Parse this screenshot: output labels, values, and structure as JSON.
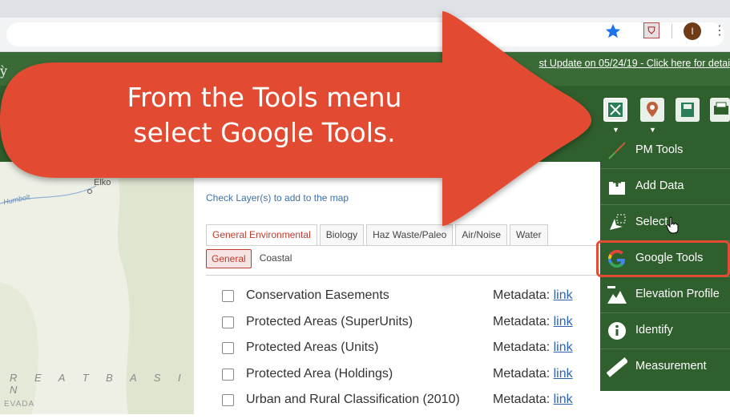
{
  "browser": {
    "profile_initial": "I",
    "menu_glyph": "⋮"
  },
  "header": {
    "update_link": "st Update on 05/24/19 - Click here for detai",
    "title_fragment": "ỳ"
  },
  "map": {
    "city": "Elko",
    "river": "Humbolt",
    "basin": "R E A T   B A S I N",
    "state": "EVADA"
  },
  "panel": {
    "hint": "Check Layer(s) to add to the map",
    "tabs": [
      {
        "label": "General Environmental",
        "active": true
      },
      {
        "label": "Biology"
      },
      {
        "label": "Haz Waste/Paleo"
      },
      {
        "label": "Air/Noise"
      },
      {
        "label": "Water"
      }
    ],
    "subtabs": [
      {
        "label": "General",
        "active": true
      },
      {
        "label": "Coastal"
      }
    ],
    "metadata_label": "Metadata:",
    "link_label": "link",
    "layers": [
      "Conservation Easements",
      "Protected Areas (SuperUnits)",
      "Protected Areas (Units)",
      "Protected Area (Holdings)",
      "Urban and Rural Classification (2010)"
    ]
  },
  "tools_menu": {
    "items": [
      {
        "label": "PM Tools",
        "icon": "pm-tools-icon"
      },
      {
        "label": "Add Data",
        "icon": "add-data-icon"
      },
      {
        "label": "Select",
        "icon": "select-icon"
      },
      {
        "label": "Google Tools",
        "icon": "google-icon"
      },
      {
        "label": "Elevation Profile",
        "icon": "elevation-profile-icon"
      },
      {
        "label": "Identify",
        "icon": "identify-icon"
      },
      {
        "label": "Measurement",
        "icon": "measurement-icon"
      }
    ],
    "highlighted": "Google Tools"
  },
  "callout": {
    "line1": "From the Tools menu",
    "line2": "select Google Tools."
  },
  "colors": {
    "header_green": "#3a6b36",
    "toolbar_green": "#2f5f2c",
    "callout_red": "#e24c33",
    "link_blue": "#2e63b0"
  }
}
